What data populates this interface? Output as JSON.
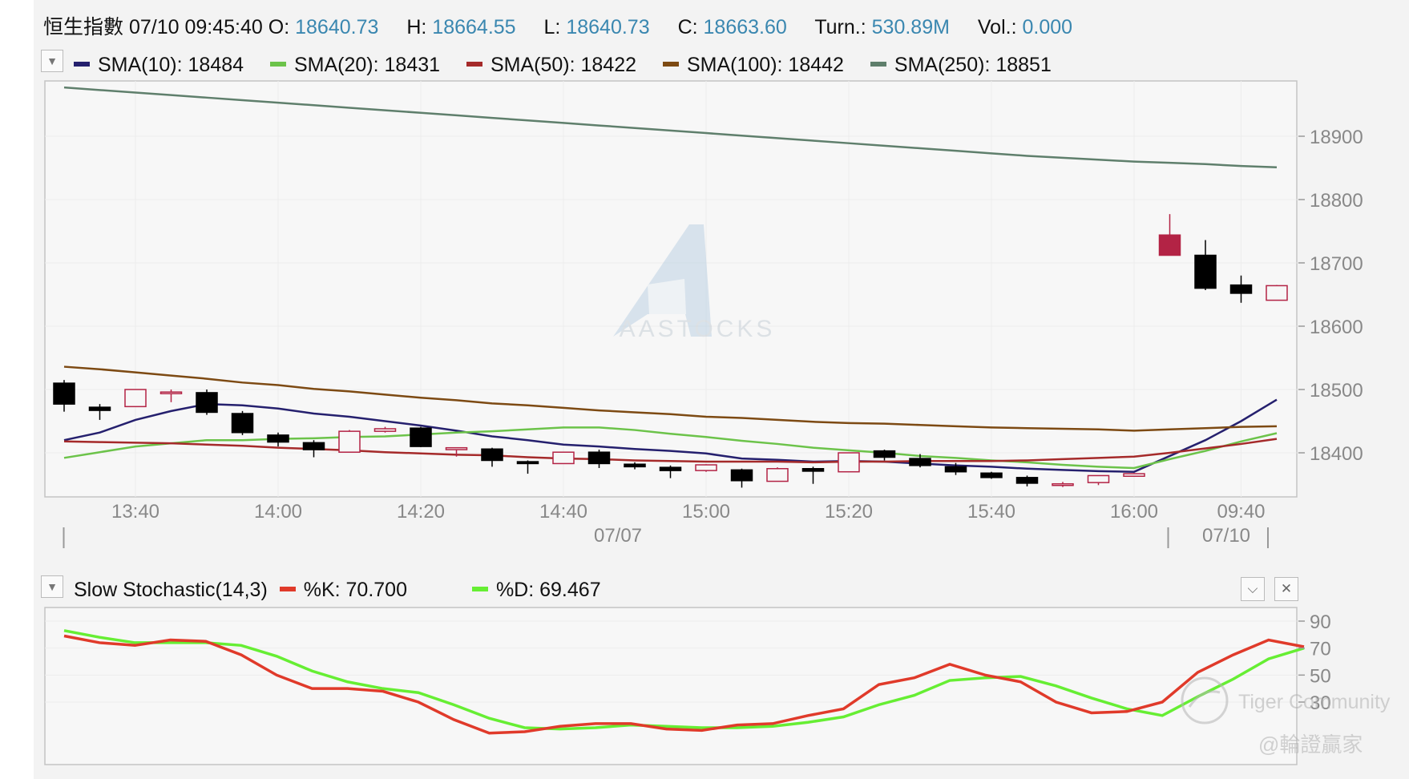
{
  "header": {
    "name": "恒生指數",
    "datetime": "07/10 09:45:40",
    "open_label": "O:",
    "open": "18640.73",
    "high_label": "H:",
    "high": "18664.55",
    "low_label": "L:",
    "low": "18640.73",
    "close_label": "C:",
    "close": "18663.60",
    "turnover_label": "Turn.:",
    "turnover": "530.89M",
    "volume_label": "Vol.:",
    "volume": "0.000"
  },
  "legend": {
    "sma10": "SMA(10): 18484",
    "sma20": "SMA(20): 18431",
    "sma50": "SMA(50): 18422",
    "sma100": "SMA(100): 18442",
    "sma250": "SMA(250): 18851"
  },
  "stoch_legend": {
    "title": "Slow Stochastic(14,3)",
    "k": "%K: 70.700",
    "d": "%D: 69.467"
  },
  "watermarks": {
    "center": "AASTOCKS",
    "brand": "Tiger Community",
    "handle": "@輪證贏家"
  },
  "colors": {
    "sma10": "#25206e",
    "sma20": "#6cc34a",
    "sma50": "#a52a2a",
    "sma100": "#7d4a13",
    "sma250": "#5f7f6c",
    "stoch_k": "#e03a2a",
    "stoch_d": "#66ee33",
    "candle_up": "#b32345",
    "candle_down": "#000000",
    "value_text": "#3a87b0"
  },
  "icons": {
    "dropdown": "▼",
    "collapse": "⌵",
    "close": "✕"
  },
  "chart_data": [
    {
      "type": "candlestick",
      "title": "",
      "y_ticks": [
        18400,
        18500,
        18600,
        18700,
        18800,
        18900
      ],
      "ylim": [
        18340,
        18990
      ],
      "x_ticks": [
        "13:40",
        "14:00",
        "14:20",
        "14:40",
        "15:00",
        "15:20",
        "15:40",
        "16:00",
        "09:40"
      ],
      "date_labels": [
        "07/07",
        "07/10"
      ],
      "candles": [
        {
          "t": "13:30",
          "o": 18510,
          "h": 18515,
          "l": 18465,
          "c": 18477
        },
        {
          "t": "13:35",
          "o": 18472,
          "h": 18477,
          "l": 18452,
          "c": 18467
        },
        {
          "t": "13:40",
          "o": 18473,
          "h": 18500,
          "l": 18473,
          "c": 18500
        },
        {
          "t": "13:45",
          "o": 18495,
          "h": 18500,
          "l": 18480,
          "c": 18496
        },
        {
          "t": "13:50",
          "o": 18495,
          "h": 18500,
          "l": 18460,
          "c": 18464
        },
        {
          "t": "13:55",
          "o": 18462,
          "h": 18466,
          "l": 18428,
          "c": 18432
        },
        {
          "t": "14:00",
          "o": 18428,
          "h": 18432,
          "l": 18410,
          "c": 18417
        },
        {
          "t": "14:05",
          "o": 18416,
          "h": 18420,
          "l": 18393,
          "c": 18405
        },
        {
          "t": "14:10",
          "o": 18401,
          "h": 18436,
          "l": 18401,
          "c": 18434
        },
        {
          "t": "14:15",
          "o": 18434,
          "h": 18441,
          "l": 18432,
          "c": 18438
        },
        {
          "t": "14:20",
          "o": 18439,
          "h": 18441,
          "l": 18409,
          "c": 18410
        },
        {
          "t": "14:25",
          "o": 18405,
          "h": 18408,
          "l": 18394,
          "c": 18408
        },
        {
          "t": "14:30",
          "o": 18406,
          "h": 18408,
          "l": 18378,
          "c": 18388
        },
        {
          "t": "14:35",
          "o": 18386,
          "h": 18388,
          "l": 18367,
          "c": 18383
        },
        {
          "t": "14:40",
          "o": 18383,
          "h": 18401,
          "l": 18383,
          "c": 18401
        },
        {
          "t": "14:45",
          "o": 18401,
          "h": 18405,
          "l": 18376,
          "c": 18383
        },
        {
          "t": "14:50",
          "o": 18382,
          "h": 18385,
          "l": 18374,
          "c": 18378
        },
        {
          "t": "14:55",
          "o": 18377,
          "h": 18380,
          "l": 18360,
          "c": 18372
        },
        {
          "t": "15:00",
          "o": 18372,
          "h": 18382,
          "l": 18370,
          "c": 18381
        },
        {
          "t": "15:05",
          "o": 18373,
          "h": 18375,
          "l": 18345,
          "c": 18356
        },
        {
          "t": "15:10",
          "o": 18355,
          "h": 18377,
          "l": 18355,
          "c": 18375
        },
        {
          "t": "15:15",
          "o": 18375,
          "h": 18378,
          "l": 18351,
          "c": 18371
        },
        {
          "t": "15:20",
          "o": 18370,
          "h": 18400,
          "l": 18370,
          "c": 18400
        },
        {
          "t": "15:25",
          "o": 18403,
          "h": 18405,
          "l": 18388,
          "c": 18393
        },
        {
          "t": "15:30",
          "o": 18391,
          "h": 18398,
          "l": 18377,
          "c": 18380
        },
        {
          "t": "15:35",
          "o": 18378,
          "h": 18384,
          "l": 18365,
          "c": 18370
        },
        {
          "t": "15:40",
          "o": 18368,
          "h": 18370,
          "l": 18359,
          "c": 18361
        },
        {
          "t": "15:45",
          "o": 18361,
          "h": 18364,
          "l": 18347,
          "c": 18352
        },
        {
          "t": "15:50",
          "o": 18350,
          "h": 18354,
          "l": 18346,
          "c": 18351
        },
        {
          "t": "15:55",
          "o": 18353,
          "h": 18364,
          "l": 18349,
          "c": 18364
        },
        {
          "t": "16:00",
          "o": 18363,
          "h": 18368,
          "l": 18362,
          "c": 18367
        },
        {
          "t": "09:30",
          "o": 18712,
          "h": 18777,
          "l": 18712,
          "c": 18744
        },
        {
          "t": "09:35",
          "o": 18712,
          "h": 18736,
          "l": 18657,
          "c": 18660
        },
        {
          "t": "09:40",
          "o": 18665,
          "h": 18680,
          "l": 18637,
          "c": 18652
        },
        {
          "t": "09:45",
          "o": 18641,
          "h": 18665,
          "l": 18641,
          "c": 18664
        }
      ],
      "series": [
        {
          "name": "SMA(10)",
          "values": [
            18420,
            18432,
            18452,
            18466,
            18477,
            18475,
            18470,
            18462,
            18457,
            18450,
            18443,
            18435,
            18426,
            18420,
            18413,
            18410,
            18406,
            18403,
            18399,
            18391,
            18389,
            18386,
            18387,
            18386,
            18383,
            18380,
            18378,
            18375,
            18373,
            18371,
            18370,
            18395,
            18420,
            18450,
            18484
          ]
        },
        {
          "name": "SMA(20)",
          "values": [
            18392,
            18401,
            18410,
            18415,
            18420,
            18420,
            18422,
            18423,
            18425,
            18426,
            18429,
            18432,
            18434,
            18437,
            18440,
            18440,
            18436,
            18430,
            18425,
            18419,
            18414,
            18408,
            18404,
            18400,
            18395,
            18392,
            18388,
            18385,
            18381,
            18378,
            18376,
            18390,
            18403,
            18418,
            18431
          ]
        },
        {
          "name": "SMA(50)",
          "values": [
            18418,
            18417,
            18416,
            18415,
            18413,
            18411,
            18408,
            18406,
            18404,
            18401,
            18399,
            18397,
            18396,
            18393,
            18391,
            18390,
            18388,
            18387,
            18386,
            18386,
            18386,
            18385,
            18386,
            18386,
            18387,
            18387,
            18387,
            18388,
            18390,
            18392,
            18394,
            18400,
            18407,
            18414,
            18422
          ]
        },
        {
          "name": "SMA(100)",
          "values": [
            18536,
            18532,
            18527,
            18522,
            18517,
            18511,
            18507,
            18501,
            18497,
            18492,
            18487,
            18483,
            18478,
            18475,
            18471,
            18467,
            18464,
            18461,
            18457,
            18455,
            18452,
            18449,
            18447,
            18446,
            18444,
            18442,
            18440,
            18439,
            18438,
            18437,
            18435,
            18437,
            18439,
            18441,
            18442
          ]
        },
        {
          "name": "SMA(250)",
          "values": [
            18977,
            18973,
            18969,
            18965,
            18961,
            18957,
            18953,
            18949,
            18945,
            18941,
            18937,
            18933,
            18929,
            18925,
            18921,
            18917,
            18913,
            18909,
            18905,
            18901,
            18897,
            18893,
            18889,
            18885,
            18881,
            18877,
            18873,
            18869,
            18866,
            18863,
            18860,
            18858,
            18856,
            18853,
            18851
          ]
        }
      ]
    },
    {
      "type": "line",
      "title": "",
      "y_ticks": [
        30,
        50,
        70,
        90
      ],
      "ylim": [
        0,
        100
      ],
      "series": [
        {
          "name": "%K",
          "values": [
            79,
            74,
            72,
            76,
            75,
            65,
            50,
            40,
            40,
            38,
            30,
            17,
            7,
            8,
            12,
            14,
            14,
            10,
            9,
            13,
            14,
            20,
            25,
            43,
            48,
            58,
            50,
            45,
            30,
            22,
            23,
            30,
            52,
            65,
            76,
            71
          ]
        },
        {
          "name": "%D",
          "values": [
            83,
            78,
            74,
            74,
            74,
            72,
            64,
            53,
            45,
            40,
            37,
            28,
            18,
            11,
            10,
            11,
            13,
            12,
            11,
            11,
            12,
            15,
            19,
            28,
            35,
            46,
            48,
            49,
            42,
            33,
            25,
            20,
            34,
            47,
            62,
            70
          ]
        }
      ]
    }
  ]
}
